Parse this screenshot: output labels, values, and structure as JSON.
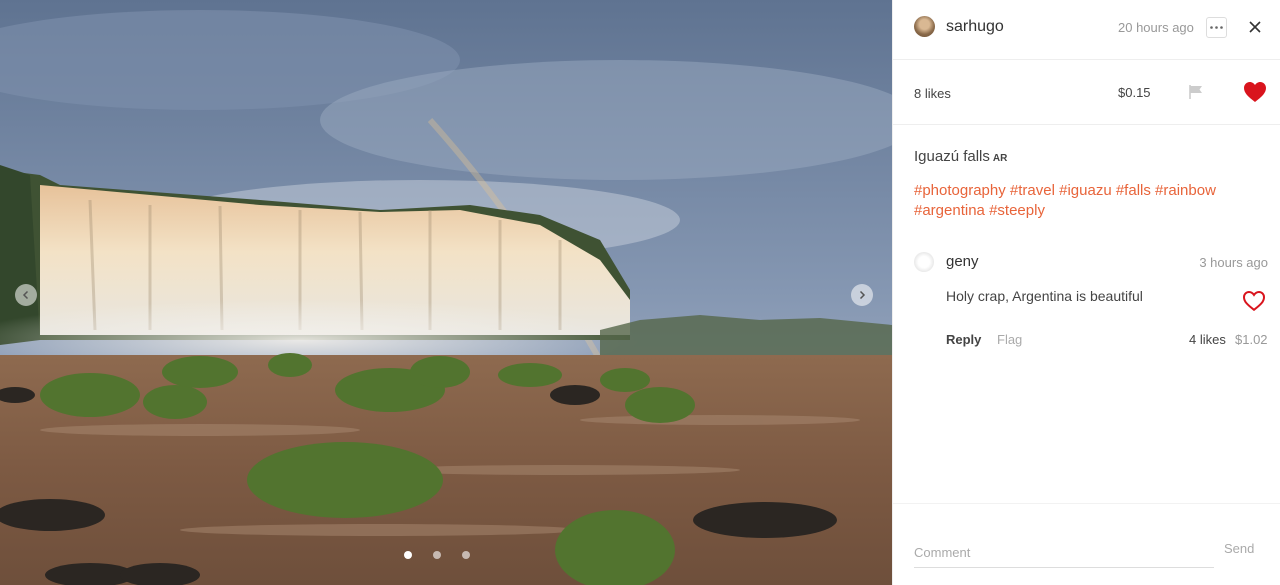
{
  "photo": {
    "alt": "Iguazú falls",
    "slides": 3,
    "active_slide": 0
  },
  "post": {
    "author": "sarhugo",
    "time": "20 hours ago",
    "likes": "8 likes",
    "payout": "$0.15",
    "liked": true,
    "title": "Iguazú falls",
    "country": "AR",
    "tags": [
      "#photography",
      "#travel",
      "#iguazu",
      "#falls",
      "#rainbow",
      "#argentina",
      "#steeply"
    ]
  },
  "comment": {
    "author": "geny",
    "time": "3 hours ago",
    "text": "Holy crap, Argentina is beautiful",
    "reply_label": "Reply",
    "flag_label": "Flag",
    "likes": "4 likes",
    "payout": "$1.02"
  },
  "composer": {
    "placeholder": "Comment",
    "send_label": "Send"
  },
  "colors": {
    "accent": "#e8643a",
    "heart": "#d9141d"
  },
  "icons": {
    "prev": "chevron-left-icon",
    "next": "chevron-right-icon",
    "more": "ellipsis-icon",
    "close": "close-icon",
    "flag": "flag-icon",
    "heart": "heart-icon"
  }
}
